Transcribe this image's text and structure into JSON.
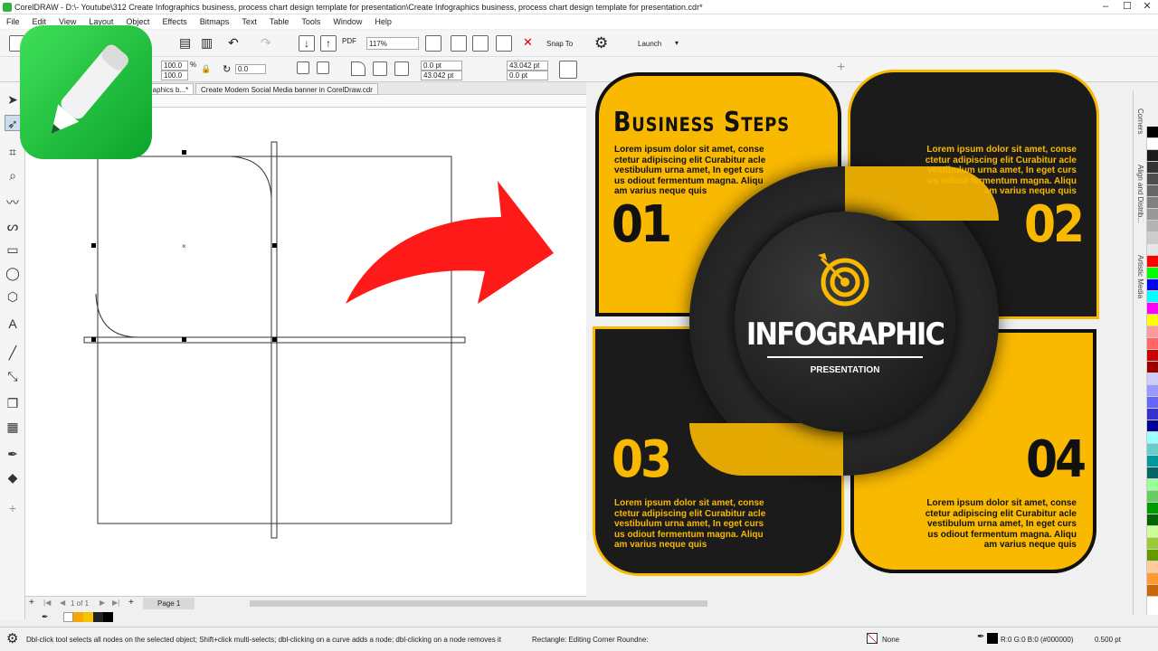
{
  "app": {
    "title": "CorelDRAW - D:\\- Youtube\\312 Create Infographics business, process chart design template for presentation\\Create Infographics business, process chart design template for presentation.cdr*",
    "menu": [
      "File",
      "Edit",
      "View",
      "Layout",
      "Object",
      "Effects",
      "Bitmaps",
      "Text",
      "Table",
      "Tools",
      "Window",
      "Help"
    ]
  },
  "toolbar": {
    "zoom": "117%",
    "snap_to": "Snap To",
    "launch": "Launch",
    "scale_w": "100.0",
    "scale_h": "100.0",
    "pct": "%",
    "rotation": "0.0",
    "corner_1": "0.0 pt",
    "corner_2": "43.042 pt",
    "corner_3": "43.042 pt",
    "corner_4": "0.0 pt",
    "pdf": "PDF"
  },
  "tabs": [
    {
      "label": "...aphics b...*"
    },
    {
      "label": "Create Modern Social Media banner in CorelDraw.cdr"
    }
  ],
  "pager": {
    "page_info": "1 of 1",
    "page_tab": "Page 1"
  },
  "status": {
    "hint": "Dbl-click tool selects all nodes on the selected object; Shift+click multi-selects; dbl-clicking on a curve adds a node; dbl-clicking on a node removes it",
    "selection": "Rectangle: Editing Corner Roundne:",
    "fill": "None",
    "outline": "R:0 G:0 B:0 (#000000)",
    "outline_width": "0.500 pt"
  },
  "dockers": [
    "Corners",
    "Align and Distrib...",
    "Artistic Media"
  ],
  "infographic": {
    "title": "Business Steps",
    "center_title": "INFOGRAPHIC",
    "center_sub": "PRESENTATION",
    "steps": [
      {
        "number": "01",
        "text": "Lorem ipsum dolor sit amet, conse ctetur adipiscing elit Curabitur acle vestibulum urna amet, In eget curs us odiout fermentum magna. Aliqu am varius neque quis"
      },
      {
        "number": "02",
        "text": "Lorem ipsum dolor sit amet, conse ctetur adipiscing elit Curabitur acle vestibulum urna amet, In eget curs us odiout fermentum magna. Aliqu am varius neque quis"
      },
      {
        "number": "03",
        "text": "Lorem ipsum dolor sit amet, conse ctetur adipiscing elit Curabitur acle vestibulum urna amet, In eget curs us odiout fermentum magna. Aliqu am varius neque quis"
      },
      {
        "number": "04",
        "text": "Lorem ipsum dolor sit amet, conse ctetur adipiscing elit Curabitur acle vestibulum urna amet, In eget curs us odiout fermentum magna. Aliqu am varius neque quis"
      }
    ],
    "colors": {
      "yellow": "#f9b900",
      "dark": "#1b1b1b",
      "arrow": "#ff1a1a"
    }
  },
  "palette": [
    "#000000",
    "#ffffff",
    "#1a1a1a",
    "#333333",
    "#4d4d4d",
    "#666666",
    "#808080",
    "#999999",
    "#b3b3b3",
    "#cccccc",
    "#e6e6e6",
    "#ff0000",
    "#00ff00",
    "#0000ff",
    "#00ffff",
    "#ff00ff",
    "#ffff00",
    "#ff9999",
    "#ff6666",
    "#cc0000",
    "#990000",
    "#ccccff",
    "#9999ff",
    "#6666ff",
    "#3333cc",
    "#000099",
    "#99ffff",
    "#66cccc",
    "#009999",
    "#006666",
    "#99ff99",
    "#66cc66",
    "#009900",
    "#006600",
    "#ccff99",
    "#99cc33",
    "#669900",
    "#ffcc99",
    "#ff9933",
    "#cc6600"
  ]
}
